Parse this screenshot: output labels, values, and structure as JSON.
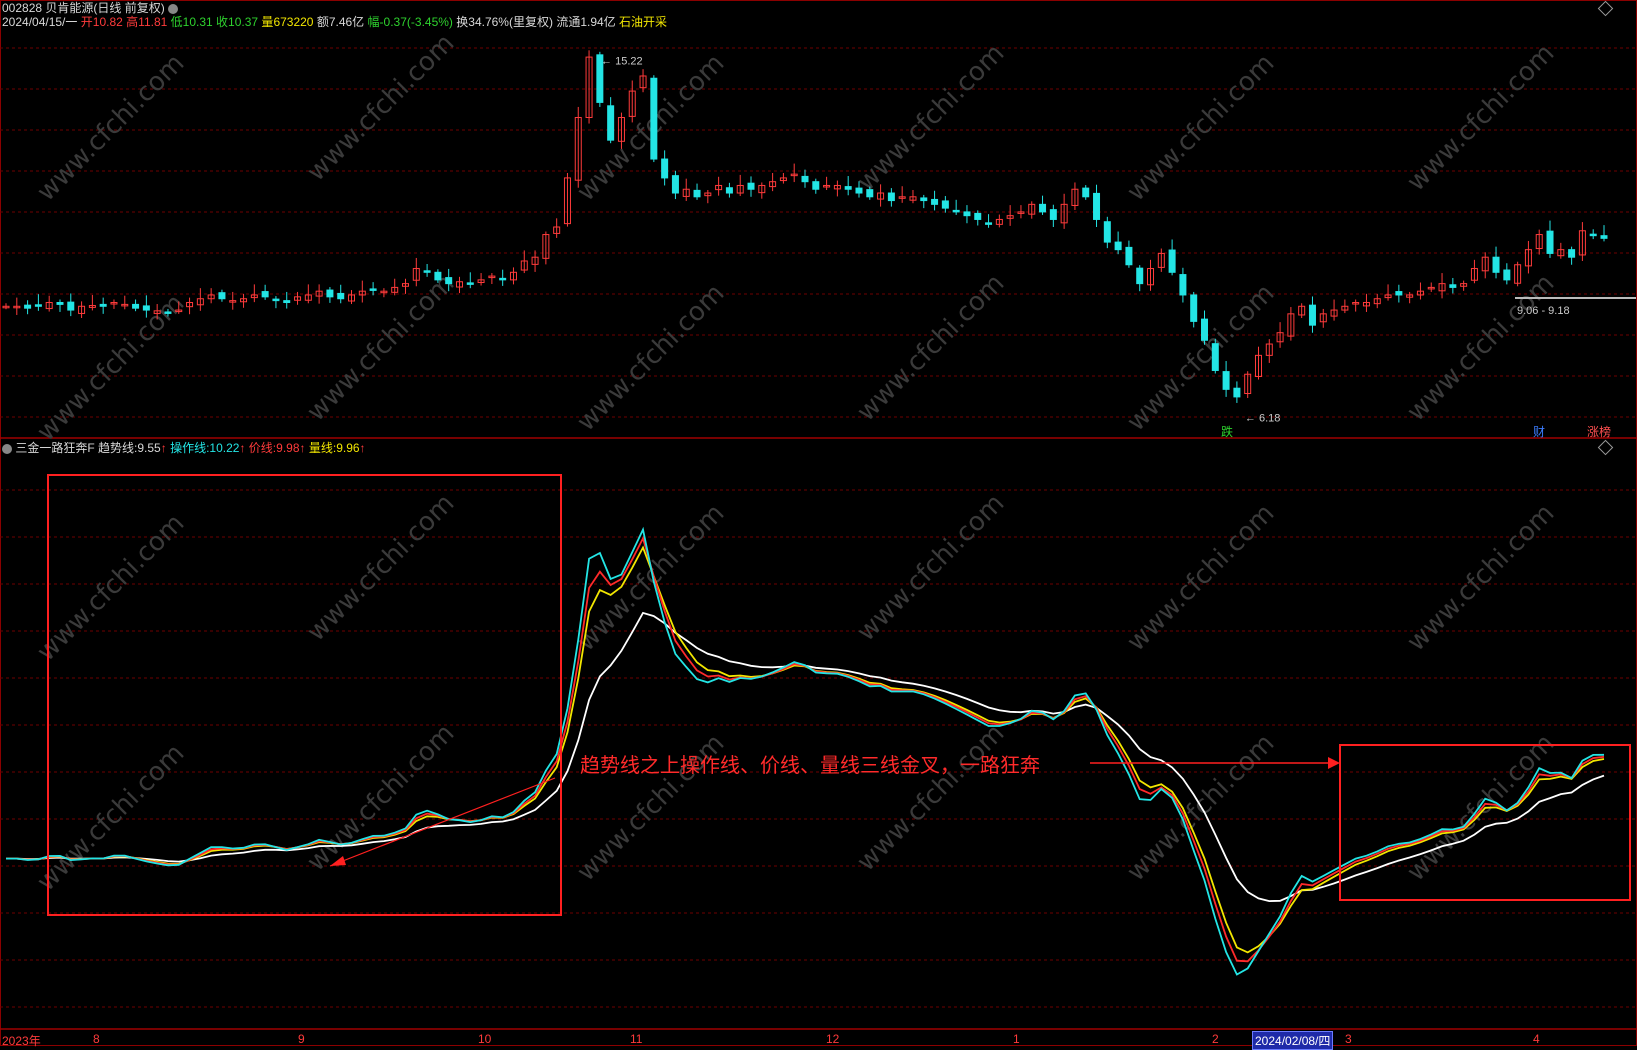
{
  "header": {
    "code": "002828",
    "name": "贝肯能源",
    "period": "(日线 前复权)",
    "date": "2024/04/15/一",
    "open_label": "开",
    "open": "10.82",
    "high_label": "高",
    "high": "11.81",
    "low_label": "低",
    "low": "10.31",
    "close_label": "收",
    "close": "10.37",
    "vol_label": "量",
    "vol": "673220",
    "amount": "额7.46亿",
    "change_label": "幅",
    "change": "-0.37(-3.45%)",
    "turnover": "换34.76%(里复权)",
    "float": "流通1.94亿",
    "industry": "石油开采"
  },
  "price_chart": {
    "high_mark": "15.22",
    "low_mark": "6.18",
    "range_label": "9.06 - 9.18",
    "badges": [
      "跌",
      "财",
      "涨榜"
    ],
    "colors": {
      "up": "#ff3b3b",
      "down": "#23e5e5"
    }
  },
  "indicator": {
    "name": "三金一路狂奔F",
    "trend_label": "趋势线:",
    "trend_value": "9.55",
    "op_label": "操作线:",
    "op_value": "10.22",
    "price_label": "价线:",
    "price_value": "9.98",
    "vol_label": "量线:",
    "vol_value": "9.96",
    "arrow": "↑",
    "annotation": "趋势线之上操作线、价线、量线三线金叉，一路狂奔",
    "colors": {
      "trend": "#ffffff",
      "op": "#23e5e5",
      "price": "#ff2a2a",
      "vol": "#f2e600",
      "box": "#ff2020"
    }
  },
  "watermark": "www.cfchi.com",
  "x_axis": {
    "year_label": "2023年",
    "months": [
      "8",
      "9",
      "10",
      "11",
      "12",
      "1",
      "2",
      "3",
      "4"
    ],
    "cursor_date": "2024/02/08/四"
  },
  "chart_data": {
    "type": "line",
    "title": "",
    "series_points_note": "",
    "candles_close": [
      8.6,
      8.6,
      8.55,
      8.6,
      8.7,
      8.65,
      8.5,
      8.6,
      8.62,
      8.6,
      8.7,
      8.65,
      8.55,
      8.5,
      8.48,
      8.45,
      8.5,
      8.7,
      8.8,
      8.9,
      8.8,
      8.75,
      8.8,
      8.9,
      8.85,
      8.75,
      8.7,
      8.85,
      8.9,
      9.0,
      8.85,
      8.8,
      8.9,
      9.0,
      9.05,
      9.0,
      9.1,
      9.2,
      9.6,
      9.5,
      9.3,
      9.2,
      9.25,
      9.2,
      9.3,
      9.4,
      9.3,
      9.5,
      9.8,
      9.9,
      10.5,
      10.7,
      12.0,
      13.6,
      15.2,
      14.0,
      13.0,
      13.6,
      14.3,
      14.7,
      12.5,
      12.0,
      11.6,
      11.7,
      11.5,
      11.6,
      11.8,
      11.6,
      11.8,
      11.7,
      11.8,
      11.9,
      12.0,
      12.1,
      11.9,
      11.7,
      11.8,
      11.8,
      11.7,
      11.6,
      11.5,
      11.6,
      11.4,
      11.5,
      11.5,
      11.4,
      11.3,
      11.2,
      11.1,
      11.0,
      10.9,
      10.8,
      10.9,
      11.0,
      11.1,
      11.3,
      11.1,
      10.9,
      11.3,
      11.7,
      11.5,
      10.9,
      10.3,
      10.1,
      9.7,
      9.2,
      9.6,
      10.0,
      9.5,
      8.9,
      8.2,
      7.7,
      6.9,
      6.4,
      6.2,
      6.8,
      7.3,
      7.6,
      7.9,
      8.4,
      8.6,
      8.1,
      8.4,
      8.5,
      8.6,
      8.7,
      8.7,
      8.8,
      8.9,
      8.9,
      8.9,
      9.0,
      9.1,
      9.2,
      9.1,
      9.2,
      9.6,
      9.9,
      9.5,
      9.3,
      9.7,
      10.1,
      10.5,
      10.0,
      10.1,
      9.9,
      10.6,
      10.5,
      10.4
    ]
  }
}
